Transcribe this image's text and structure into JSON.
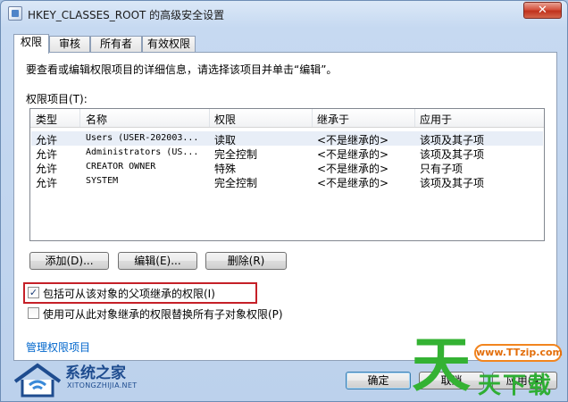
{
  "window": {
    "title": "HKEY_CLASSES_ROOT 的高级安全设置",
    "close_label": "✕"
  },
  "tabs": [
    {
      "label": "权限",
      "active": true
    },
    {
      "label": "审核",
      "active": false
    },
    {
      "label": "所有者",
      "active": false
    },
    {
      "label": "有效权限",
      "active": false
    }
  ],
  "panel": {
    "instruction": "要查看或编辑权限项目的详细信息，请选择该项目并单击“编辑”。",
    "list_label": "权限项目(T):",
    "columns": [
      "类型",
      "名称",
      "权限",
      "继承于",
      "应用于"
    ],
    "rows": [
      {
        "type": "允许",
        "name": "Users (USER-202003...",
        "permission": "读取",
        "inherited": "<不是继承的>",
        "applies": "该项及其子项"
      },
      {
        "type": "允许",
        "name": "Administrators (US...",
        "permission": "完全控制",
        "inherited": "<不是继承的>",
        "applies": "该项及其子项"
      },
      {
        "type": "允许",
        "name": "CREATOR OWNER",
        "permission": "特殊",
        "inherited": "<不是继承的>",
        "applies": "只有子项"
      },
      {
        "type": "允许",
        "name": "SYSTEM",
        "permission": "完全控制",
        "inherited": "<不是继承的>",
        "applies": "该项及其子项"
      }
    ],
    "buttons": {
      "add": "添加(D)...",
      "edit": "编辑(E)...",
      "remove": "删除(R)"
    },
    "include_inheritable": {
      "label": "包括可从该对象的父项继承的权限(I)",
      "checked": true
    },
    "replace_child": {
      "label": "使用可从此对象继承的权限替换所有子对象权限(P)",
      "checked": false
    },
    "manage_link": "管理权限项目"
  },
  "footer": {
    "ok": "确定",
    "cancel": "取消",
    "apply": "应用(A)"
  },
  "watermarks": {
    "left_cn": "系统之家",
    "left_en": "XITONGZHIJIA.NET",
    "right_big": "天",
    "right_pill": "www.TTzip.com",
    "right_sub": "天下载"
  },
  "colors": {
    "highlight_border": "#c52028",
    "link": "#0066cc",
    "title_bg": "#c6d9f1"
  }
}
